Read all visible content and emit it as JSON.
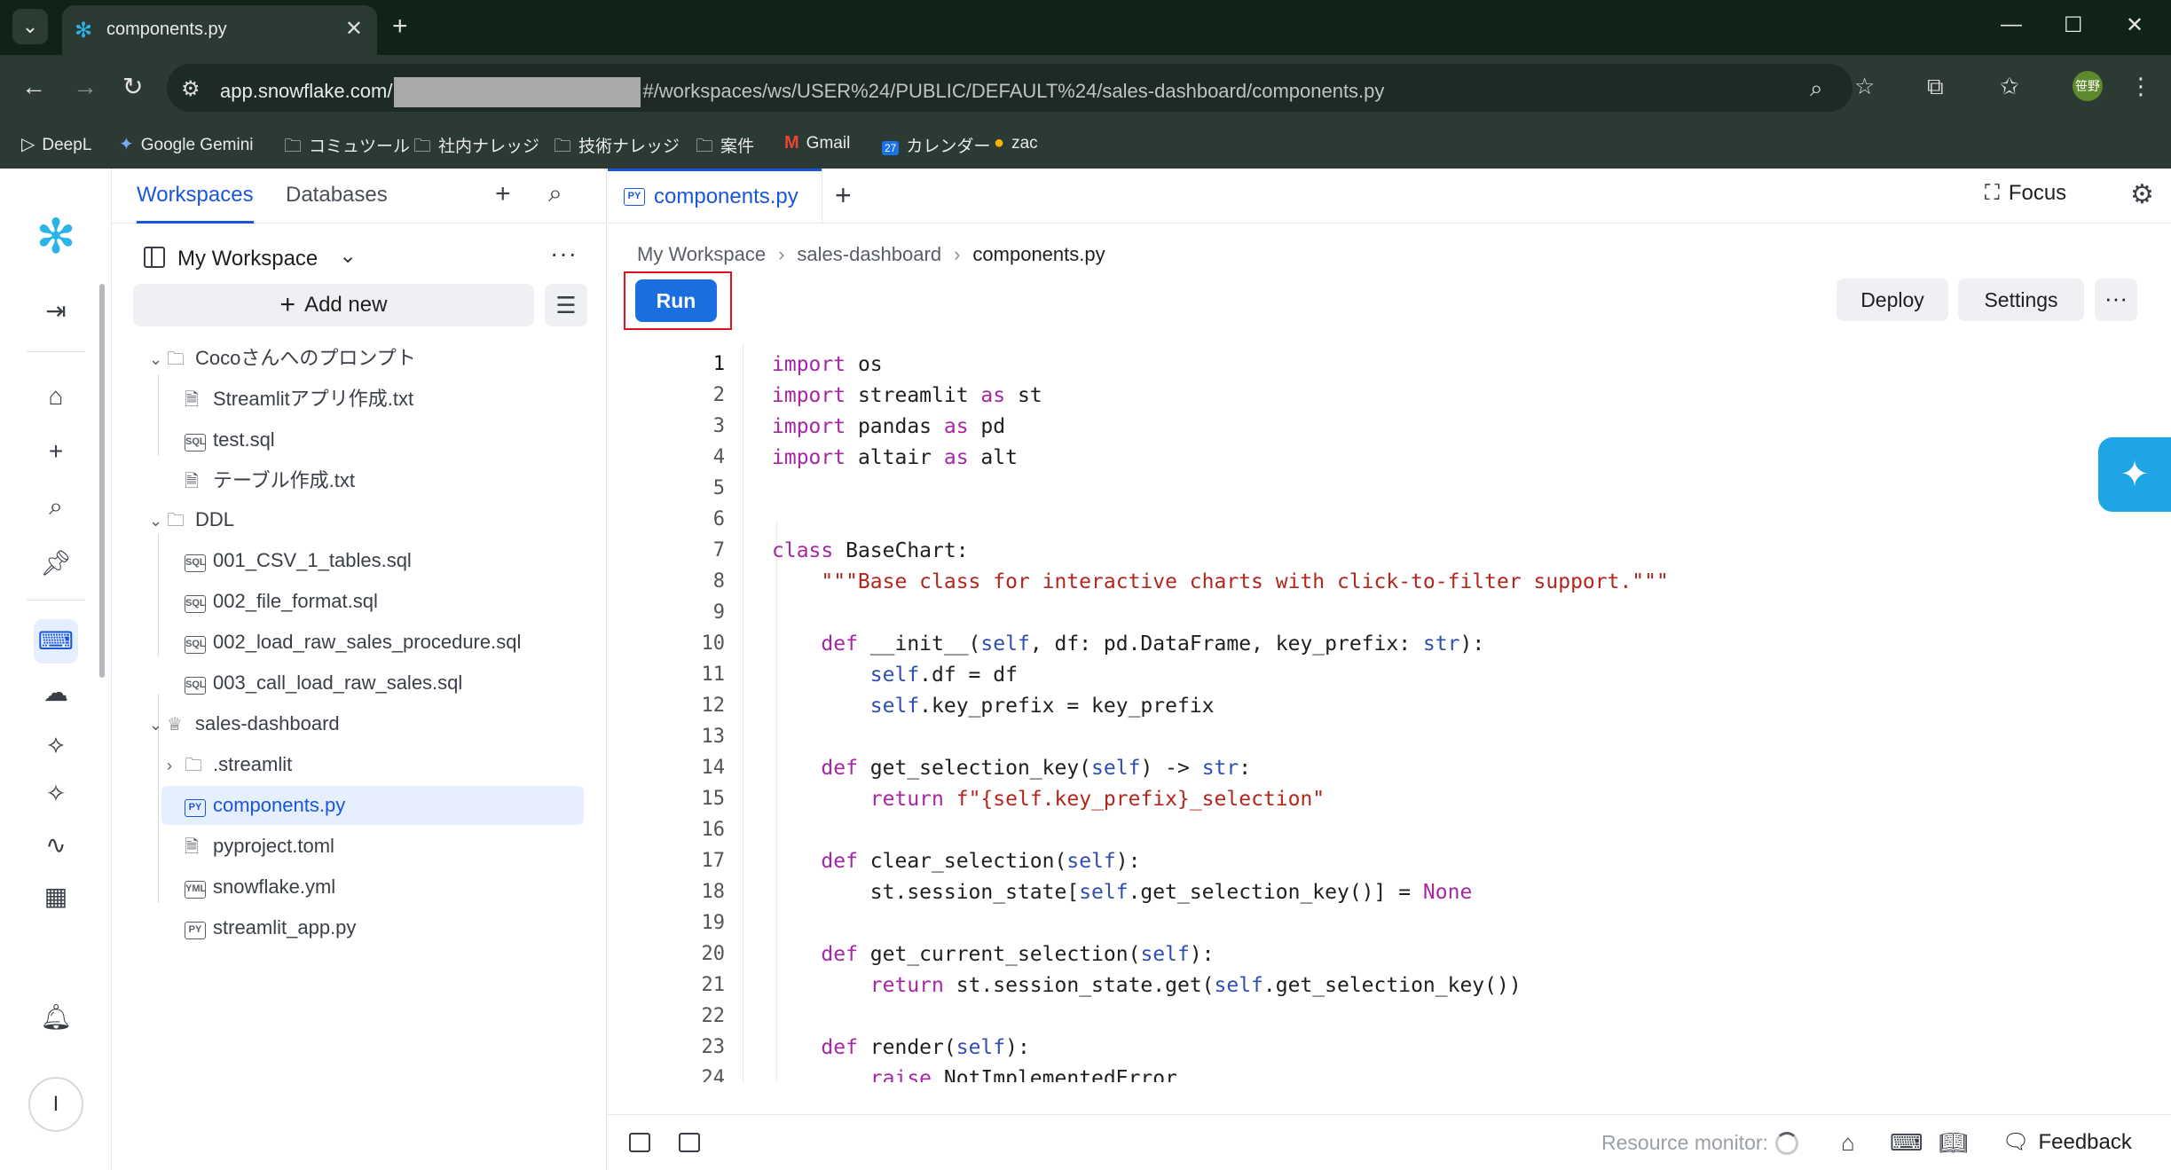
{
  "browser": {
    "tab_title": "components.py",
    "url_host": "app.snowflake.com/",
    "url_path": "#/workspaces/ws/USER%24/PUBLIC/DEFAULT%24/sales-dashboard/components.py",
    "avatar_text": "笹野",
    "bookmarks": [
      {
        "label": "DeepL",
        "icon": "deepl-icon"
      },
      {
        "label": "Google Gemini",
        "icon": "gemini-icon"
      },
      {
        "label": "コミュツール",
        "icon": "folder-icon"
      },
      {
        "label": "社内ナレッジ",
        "icon": "folder-icon"
      },
      {
        "label": "技術ナレッジ",
        "icon": "folder-icon"
      },
      {
        "label": "案件",
        "icon": "folder-icon"
      },
      {
        "label": "Gmail",
        "icon": "gmail-icon"
      },
      {
        "label": "カレンダー",
        "icon": "calendar-icon"
      },
      {
        "label": "zac",
        "icon": "zac-icon"
      }
    ],
    "calendar_day": "27"
  },
  "rail": {
    "profile_initial": "I"
  },
  "sidebar": {
    "tabs": [
      {
        "label": "Workspaces",
        "active": true
      },
      {
        "label": "Databases",
        "active": false
      }
    ],
    "workspace_name": "My Workspace",
    "add_new_label": "Add new",
    "tree": [
      {
        "label": "Cocoさんへのプロンプト",
        "type": "folder",
        "depth": 0,
        "expanded": true
      },
      {
        "label": "Streamlitアプリ作成.txt",
        "type": "file",
        "depth": 1
      },
      {
        "label": "test.sql",
        "type": "sql",
        "depth": 1
      },
      {
        "label": "テーブル作成.txt",
        "type": "file",
        "depth": 1
      },
      {
        "label": "DDL",
        "type": "folder",
        "depth": 0,
        "expanded": true
      },
      {
        "label": "001_CSV_1_tables.sql",
        "type": "sql",
        "depth": 1
      },
      {
        "label": "002_file_format.sql",
        "type": "sql",
        "depth": 1
      },
      {
        "label": "002_load_raw_sales_procedure.sql",
        "type": "sql",
        "depth": 1
      },
      {
        "label": "003_call_load_raw_sales.sql",
        "type": "sql",
        "depth": 1
      },
      {
        "label": "sales-dashboard",
        "type": "app",
        "depth": 0,
        "expanded": true
      },
      {
        "label": ".streamlit",
        "type": "folder",
        "depth": 1,
        "expanded": false
      },
      {
        "label": "components.py",
        "type": "py",
        "depth": 1,
        "selected": true
      },
      {
        "label": "pyproject.toml",
        "type": "file",
        "depth": 1
      },
      {
        "label": "snowflake.yml",
        "type": "yml",
        "depth": 1
      },
      {
        "label": "streamlit_app.py",
        "type": "py",
        "depth": 1
      }
    ]
  },
  "editor": {
    "tab_label": "components.py",
    "focus_label": "Focus",
    "breadcrumb": [
      "My Workspace",
      "sales-dashboard",
      "components.py"
    ],
    "run_label": "Run",
    "deploy_label": "Deploy",
    "settings_label": "Settings",
    "current_line": 1,
    "lines": [
      "import os",
      "import streamlit as st",
      "import pandas as pd",
      "import altair as alt",
      "",
      "",
      "class BaseChart:",
      "    \"\"\"Base class for interactive charts with click-to-filter support.\"\"\"",
      "",
      "    def __init__(self, df: pd.DataFrame, key_prefix: str):",
      "        self.df = df",
      "        self.key_prefix = key_prefix",
      "",
      "    def get_selection_key(self) -> str:",
      "        return f\"{self.key_prefix}_selection\"",
      "",
      "    def clear_selection(self):",
      "        st.session_state[self.get_selection_key()] = None",
      "",
      "    def get_current_selection(self):",
      "        return st.session_state.get(self.get_selection_key())",
      "",
      "    def render(self):",
      "        raise NotImplementedError",
      ""
    ]
  },
  "statusbar": {
    "resource_monitor_label": "Resource monitor:",
    "feedback_label": "Feedback"
  }
}
